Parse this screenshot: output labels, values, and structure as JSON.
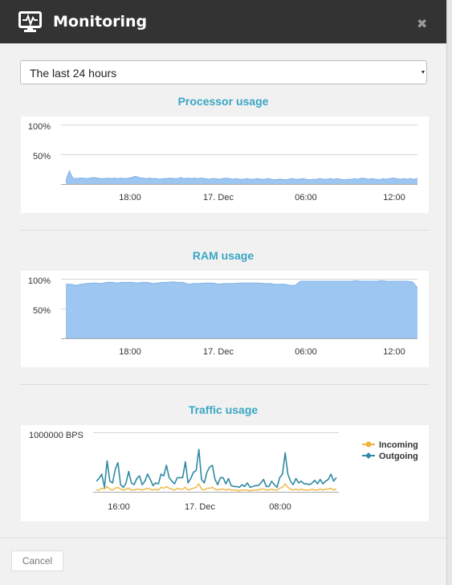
{
  "window": {
    "title": "Monitoring",
    "icon": "monitor-pulse-icon",
    "close_icon": "close-icon"
  },
  "range_select": {
    "value": "The last 24 hours"
  },
  "colors": {
    "header_bg": "#333333",
    "title_accent": "#3aa6c4",
    "area_fill": "#9dc6f0",
    "area_line": "#7fb1e8",
    "incoming": "#f0b43c",
    "outgoing": "#2f8aa3"
  },
  "footer": {
    "cancel_label": "Cancel"
  },
  "chart_data": [
    {
      "type": "area",
      "title": "Processor usage",
      "y_ticks": [
        "100%",
        "50%"
      ],
      "x_ticks": [
        "18:00",
        "17. Dec",
        "06:00",
        "12:00"
      ],
      "ylim": [
        0,
        100
      ],
      "series": [
        {
          "values": [
            5,
            22,
            10,
            9,
            10,
            10,
            9,
            10,
            11,
            10,
            9,
            9,
            10,
            9,
            10,
            9,
            10,
            9,
            10,
            11,
            13,
            11,
            10,
            9,
            10,
            9,
            9,
            8,
            9,
            9,
            10,
            9,
            9,
            11,
            9,
            10,
            9,
            10,
            9,
            10,
            9,
            8,
            9,
            9,
            8,
            9,
            10,
            9,
            8,
            9,
            8,
            8,
            9,
            8,
            8,
            9,
            8,
            8,
            9,
            8,
            7,
            8,
            8,
            7,
            8,
            9,
            8,
            8,
            9,
            8,
            7,
            8,
            8,
            9,
            8,
            8,
            9,
            8,
            9,
            8,
            7,
            8,
            8,
            9,
            8,
            10,
            9,
            8,
            9,
            8,
            7,
            9,
            8,
            9,
            10,
            9,
            8,
            9,
            8,
            9,
            8,
            9
          ]
        }
      ],
      "grid": true
    },
    {
      "type": "area",
      "title": "RAM usage",
      "y_ticks": [
        "100%",
        "50%"
      ],
      "x_ticks": [
        "18:00",
        "17. Dec",
        "06:00",
        "12:00"
      ],
      "ylim": [
        0,
        100
      ],
      "series": [
        {
          "values": [
            91,
            91,
            89,
            91,
            92,
            93,
            93,
            92,
            94,
            94,
            93,
            94,
            94,
            94,
            93,
            94,
            94,
            92,
            93,
            94,
            94,
            95,
            94,
            94,
            91,
            92,
            92,
            93,
            93,
            93,
            91,
            92,
            92,
            92,
            93,
            93,
            93,
            93,
            93,
            92,
            92,
            91,
            91,
            91,
            89,
            89,
            96,
            96,
            96,
            96,
            96,
            96,
            96,
            96,
            96,
            96,
            96,
            97,
            96,
            96,
            96,
            96,
            97,
            96,
            96,
            96,
            96,
            96,
            95,
            85
          ]
        }
      ],
      "grid": true
    },
    {
      "type": "line",
      "title": "Traffic usage",
      "y_ticks": [
        "1000000 BPS"
      ],
      "x_ticks": [
        "16:00",
        "17. Dec",
        "08:00"
      ],
      "legend": "top-right",
      "series": [
        {
          "name": "Incoming",
          "values": [
            2,
            2,
            4,
            3,
            6,
            3,
            2,
            4,
            5,
            3,
            2,
            3,
            4,
            2,
            2,
            3,
            3,
            2,
            3,
            4,
            3,
            2,
            3,
            2,
            5,
            4,
            6,
            4,
            3,
            2,
            4,
            3,
            3,
            5,
            2,
            3,
            4,
            5,
            9,
            3,
            2,
            4,
            4,
            5,
            3,
            2,
            3,
            3,
            2,
            3,
            2,
            2,
            2,
            1,
            2,
            2,
            2,
            1,
            2,
            2,
            2,
            3,
            3,
            2,
            2,
            3,
            2,
            2,
            4,
            5,
            9,
            5,
            3,
            2,
            3,
            2,
            3,
            2,
            2,
            2,
            3,
            2,
            2,
            3,
            2,
            3,
            3,
            4,
            2,
            3
          ]
        },
        {
          "name": "Outgoing",
          "values": [
            12,
            15,
            20,
            5,
            35,
            12,
            10,
            25,
            33,
            8,
            5,
            10,
            23,
            10,
            8,
            15,
            18,
            8,
            12,
            20,
            14,
            7,
            10,
            9,
            20,
            18,
            30,
            16,
            12,
            9,
            16,
            16,
            16,
            34,
            10,
            15,
            22,
            24,
            48,
            14,
            10,
            22,
            28,
            30,
            14,
            8,
            16,
            16,
            9,
            15,
            7,
            6,
            6,
            5,
            8,
            6,
            10,
            5,
            6,
            7,
            7,
            10,
            14,
            6,
            6,
            12,
            8,
            5,
            16,
            20,
            44,
            20,
            12,
            8,
            15,
            10,
            12,
            9,
            9,
            8,
            10,
            13,
            9,
            14,
            9,
            12,
            14,
            20,
            12,
            16
          ]
        }
      ],
      "grid": true
    }
  ]
}
